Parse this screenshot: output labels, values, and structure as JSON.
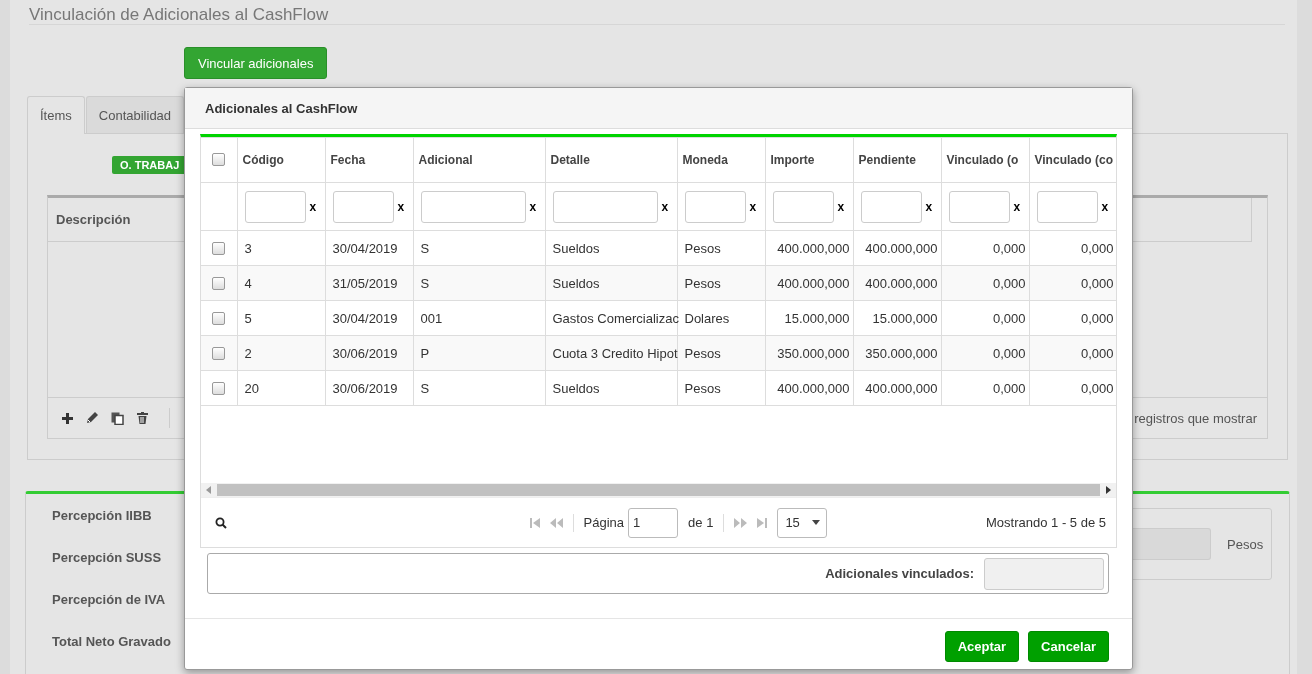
{
  "page": {
    "title": "Vinculación de Adicionales al CashFlow",
    "action_button": "Vincular adicionales"
  },
  "tabs": [
    {
      "label": "Ítems",
      "selected": true
    },
    {
      "label": "Contabilidad",
      "selected": false
    }
  ],
  "items_panel": {
    "badge": "O. TRABAJ",
    "grid_header": "Descripción",
    "pager_text": "registros que mostrar"
  },
  "totals": {
    "labels": [
      "Percepción IIBB",
      "Percepción SUSS",
      "Percepción de IVA",
      "Total Neto Gravado"
    ],
    "currency": "Pesos"
  },
  "dialog": {
    "title": "Adicionales al CashFlow",
    "select_all": {
      "checked": false
    },
    "columns": [
      {
        "label": "Código",
        "kind": "text",
        "filter_clear": "x"
      },
      {
        "label": "Fecha",
        "kind": "text",
        "filter_clear": "x"
      },
      {
        "label": "Adicional",
        "kind": "text",
        "filter_clear": "x"
      },
      {
        "label": "Detalle",
        "kind": "text",
        "filter_clear": "x"
      },
      {
        "label": "Moneda",
        "kind": "text",
        "filter_clear": "x"
      },
      {
        "label": "Importe",
        "kind": "number",
        "filter_clear": "x"
      },
      {
        "label": "Pendiente",
        "kind": "number",
        "filter_clear": "x"
      },
      {
        "label": "Vinculado (o",
        "kind": "number",
        "filter_clear": "x"
      },
      {
        "label": "Vinculado (co",
        "kind": "number",
        "filter_clear": "x"
      }
    ],
    "rows": [
      {
        "selected": false,
        "cells": [
          "3",
          "30/04/2019",
          "S",
          "Sueldos",
          "Pesos",
          "400.000,000",
          "400.000,000",
          "0,000",
          "0,000"
        ]
      },
      {
        "selected": false,
        "cells": [
          "4",
          "31/05/2019",
          "S",
          "Sueldos",
          "Pesos",
          "400.000,000",
          "400.000,000",
          "0,000",
          "0,000"
        ]
      },
      {
        "selected": false,
        "cells": [
          "5",
          "30/04/2019",
          "001",
          "Gastos Comercializac",
          "Dolares",
          "15.000,000",
          "15.000,000",
          "0,000",
          "0,000"
        ]
      },
      {
        "selected": false,
        "cells": [
          "2",
          "30/06/2019",
          "P",
          "Cuota 3 Credito Hipot",
          "Pesos",
          "350.000,000",
          "350.000,000",
          "0,000",
          "0,000"
        ]
      },
      {
        "selected": false,
        "cells": [
          "20",
          "30/06/2019",
          "S",
          "Sueldos",
          "Pesos",
          "400.000,000",
          "400.000,000",
          "0,000",
          "0,000"
        ]
      }
    ],
    "pager": {
      "page_label": "Página",
      "page": "1",
      "of": "de 1",
      "page_size": "15",
      "summary": "Mostrando 1 - 5 de 5"
    },
    "linked_label": "Adicionales vinculados:",
    "buttons": [
      "Aceptar",
      "Cancelar"
    ]
  }
}
